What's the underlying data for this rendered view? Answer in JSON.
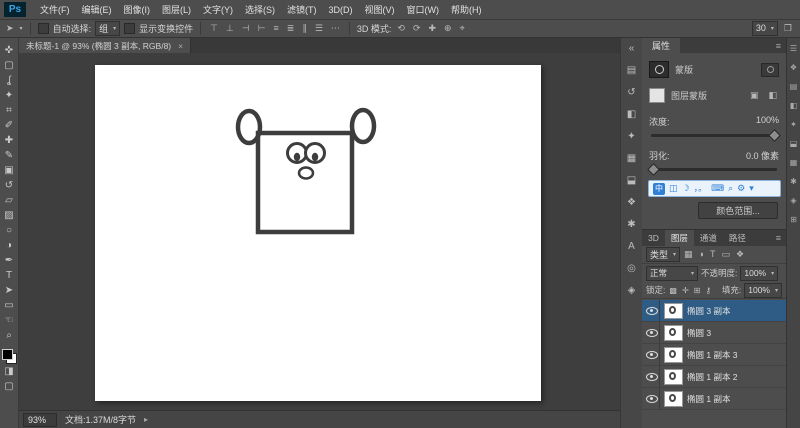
{
  "colors": {
    "ui_background": "#4d4d4d",
    "canvas_surround": "#3e3e3e",
    "selected_layer": "#2e5c85",
    "ime_accent": "#2f7fd6",
    "logo_blue": "#3aa8e8"
  },
  "ui": {
    "chevron_down": "▾",
    "chevron_right": "▸",
    "menu_icon": "≡",
    "tool_preset_icon": "➤",
    "window_icon": "❐"
  },
  "menubar": {
    "logo": "Ps",
    "items": [
      "文件(F)",
      "编辑(E)",
      "图像(I)",
      "图层(L)",
      "文字(Y)",
      "选择(S)",
      "滤镜(T)",
      "3D(D)",
      "视图(V)",
      "窗口(W)",
      "帮助(H)"
    ]
  },
  "options_bar": {
    "auto_select_label": "自动选择:",
    "auto_select_value": "组",
    "show_transform_label": "显示变换控件",
    "mode3d_label": "3D 模式:",
    "zoom_field": "30",
    "align_icons": [
      "⊤",
      "⊥",
      "⊣",
      "⊢",
      "≡",
      "≣",
      "∥",
      "☰",
      "⋯"
    ],
    "mode3d_icons": [
      "⟲",
      "⟳",
      "✚",
      "⊕",
      "⌖"
    ]
  },
  "toolbar": {
    "tools": [
      {
        "name": "move-tool",
        "glyph": "✜"
      },
      {
        "name": "rectangular-marquee-tool",
        "glyph": "▢"
      },
      {
        "name": "lasso-tool",
        "glyph": "ʆ"
      },
      {
        "name": "quick-selection-tool",
        "glyph": "✦"
      },
      {
        "name": "crop-tool",
        "glyph": "⌗"
      },
      {
        "name": "eyedropper-tool",
        "glyph": "✐"
      },
      {
        "name": "healing-brush-tool",
        "glyph": "✚"
      },
      {
        "name": "brush-tool",
        "glyph": "✎"
      },
      {
        "name": "clone-stamp-tool",
        "glyph": "▣"
      },
      {
        "name": "history-brush-tool",
        "glyph": "↺"
      },
      {
        "name": "eraser-tool",
        "glyph": "▱"
      },
      {
        "name": "gradient-tool",
        "glyph": "▨"
      },
      {
        "name": "blur-tool",
        "glyph": "○"
      },
      {
        "name": "dodge-tool",
        "glyph": "◑"
      },
      {
        "name": "pen-tool",
        "glyph": "✒"
      },
      {
        "name": "type-tool",
        "glyph": "T"
      },
      {
        "name": "path-selection-tool",
        "glyph": "➤"
      },
      {
        "name": "rectangle-tool",
        "glyph": "▭"
      },
      {
        "name": "hand-tool",
        "glyph": "☜"
      },
      {
        "name": "zoom-tool",
        "glyph": "⌕"
      }
    ],
    "extras": [
      "◨",
      "▢"
    ]
  },
  "document": {
    "tab_title": "未标题-1 @ 93% (椭圆 3 副本, RGB/8)",
    "close_label": "×"
  },
  "properties_panel": {
    "tab": "属性",
    "section_title": "蒙版",
    "mask_type_label": "图层蒙版",
    "density_label": "浓度:",
    "density_value": "100%",
    "feather_label": "羽化:",
    "feather_value": "0.0 像素",
    "color_range_label": "颜色范围...",
    "pixel_mask_icon": "▣",
    "vector_mask_icon": "◧"
  },
  "ime_bar": {
    "mode": "中",
    "icons": [
      "◫",
      "☽",
      "，。",
      "⌨",
      "⌕",
      "⚙",
      "▾"
    ]
  },
  "layers_panel": {
    "tabs": [
      "3D",
      "图层",
      "通道",
      "路径"
    ],
    "active_tab": "图层",
    "kind_label": "类型",
    "filter_icons": [
      "▦",
      "◑",
      "T",
      "▭",
      "❖"
    ],
    "blend_mode": "正常",
    "opacity_label": "不透明度:",
    "opacity_value": "100%",
    "lock_label": "锁定:",
    "lock_icons": [
      "▩",
      "✛",
      "⊞",
      "⚷"
    ],
    "fill_label": "填充:",
    "fill_value": "100%",
    "layers": [
      "椭圆 3 副本",
      "椭圆 3",
      "椭圆 1 副本 3",
      "椭圆 1 副本 2",
      "椭圆 1 副本"
    ],
    "selected_layer": "椭圆 3 副本"
  },
  "statusbar": {
    "zoom": "93%",
    "doc_info": "文档:1.37M/8字节"
  },
  "dock_icons": [
    "«",
    "▤",
    "↺",
    "◧",
    "✦",
    "▦",
    "⬓",
    "❖",
    "✱",
    "A",
    "◎",
    "◈"
  ],
  "edge_icons": [
    "☰",
    "❖",
    "▤",
    "◧",
    "✦",
    "⬓",
    "▦",
    "✱",
    "◈",
    "⊞"
  ]
}
